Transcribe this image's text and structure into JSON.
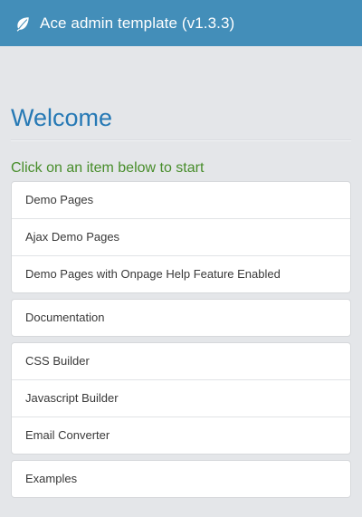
{
  "navbar": {
    "icon": "leaf-icon",
    "title": "Ace admin template (v1.3.3)",
    "background": "#438eb9"
  },
  "main": {
    "heading": "Welcome",
    "subtitle": "Click on an item below to start",
    "groups": [
      {
        "items": [
          {
            "label": "Demo Pages"
          },
          {
            "label": "Ajax Demo Pages"
          },
          {
            "label": "Demo Pages with Onpage Help Feature Enabled"
          }
        ]
      },
      {
        "items": [
          {
            "label": "Documentation"
          }
        ]
      },
      {
        "items": [
          {
            "label": "CSS Builder"
          },
          {
            "label": "Javascript Builder"
          },
          {
            "label": "Email Converter"
          }
        ]
      },
      {
        "items": [
          {
            "label": "Examples"
          }
        ]
      }
    ]
  },
  "colors": {
    "heading": "#2679b5",
    "subtitle": "#478d2a",
    "page_background": "#e4e6e9"
  }
}
